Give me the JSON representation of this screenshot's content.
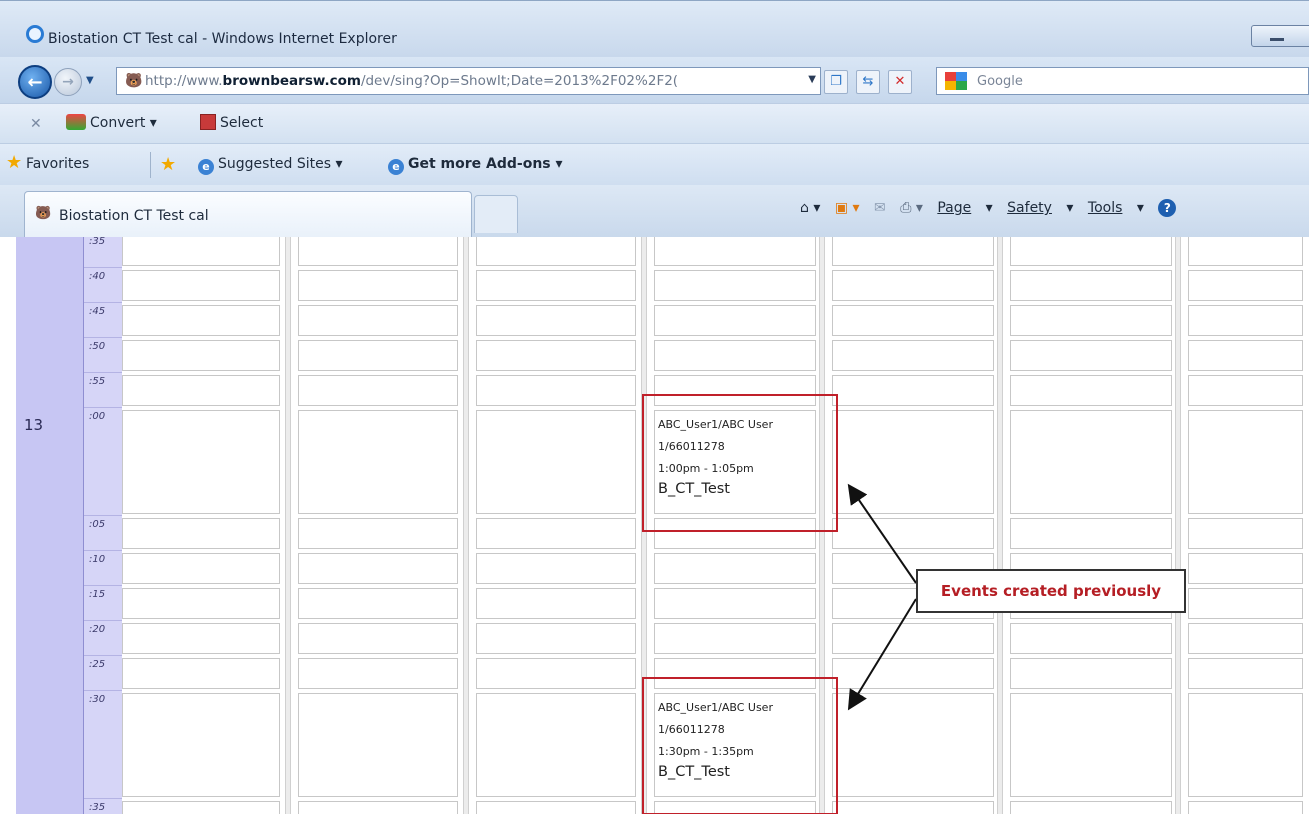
{
  "window": {
    "title": "Biostation CT Test cal - Windows Internet Explorer"
  },
  "address": {
    "prefix": "http://www.",
    "domain": "brownbearsw.com",
    "path": "/dev/sing?Op=ShowIt;Date=2013%2F02%2F2("
  },
  "search": {
    "placeholder": "Google"
  },
  "command_bar": {
    "convert": "Convert",
    "select": "Select"
  },
  "favorites_bar": {
    "favorites": "Favorites",
    "suggested": "Suggested Sites",
    "addons": "Get more Add-ons"
  },
  "tab": {
    "title": "Biostation CT Test cal"
  },
  "toolbar": {
    "page": "Page",
    "safety": "Safety",
    "tools": "Tools"
  },
  "calendar": {
    "hour_12_minutes": [
      ":35",
      ":40",
      ":45",
      ":50",
      ":55"
    ],
    "hour_13": "13",
    "hour_13_minutes": [
      ":00",
      ":05",
      ":10",
      ":15",
      ":20",
      ":25",
      ":30",
      ":35"
    ],
    "events": [
      {
        "user": "ABC_User1/ABC User",
        "id": "1/66011278",
        "time": "1:00pm - 1:05pm",
        "title": "B_CT_Test"
      },
      {
        "user": "ABC_User1/ABC User",
        "id": "1/66011278",
        "time": "1:30pm - 1:35pm",
        "title": "B_CT_Test"
      }
    ]
  },
  "annotation": {
    "callout": "Events created previously"
  }
}
